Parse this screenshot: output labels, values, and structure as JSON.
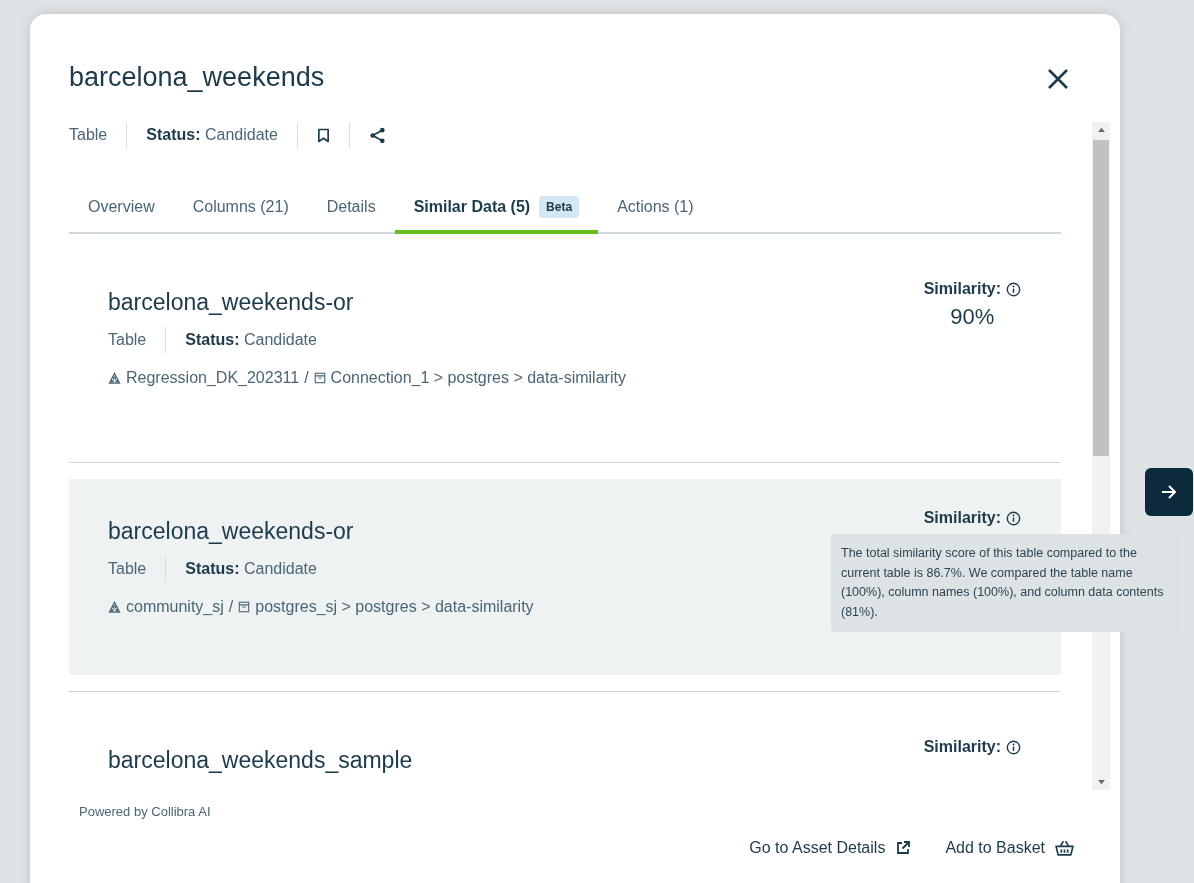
{
  "dialog": {
    "title": "barcelona_weekends",
    "type": "Table",
    "status_label": "Status:",
    "status": "Candidate"
  },
  "tabs": [
    {
      "label": "Overview",
      "selected": false
    },
    {
      "label": "Columns (21)",
      "selected": false
    },
    {
      "label": "Details",
      "selected": false
    },
    {
      "label": "Similar Data (5)",
      "badge": "Beta",
      "selected": true
    },
    {
      "label": "Actions (1)",
      "selected": false
    }
  ],
  "results": [
    {
      "title": "barcelona_weekends-or",
      "type": "Table",
      "status_label": "Status:",
      "status": "Candidate",
      "path": [
        {
          "kind": "community",
          "text": "Regression_DK_202311"
        },
        {
          "kind": "separator",
          "text": "/"
        },
        {
          "kind": "system",
          "text": "Connection_1 > postgres > data-similarity"
        }
      ],
      "similarity_label": "Similarity:",
      "similarity": "90%",
      "highlighted": false
    },
    {
      "title": "barcelona_weekends-or",
      "type": "Table",
      "status_label": "Status:",
      "status": "Candidate",
      "path": [
        {
          "kind": "community",
          "text": "community_sj"
        },
        {
          "kind": "separator",
          "text": "/"
        },
        {
          "kind": "system",
          "text": "postgres_sj > postgres > data-similarity"
        }
      ],
      "similarity_label": "Similarity:",
      "highlighted": true,
      "tooltip": "The total similarity score of this table compared to the current table is 86.7%. We compared the table name (100%), column names (100%), and column data contents (81%)."
    },
    {
      "title": "barcelona_weekends_sample",
      "similarity_label": "Similarity:",
      "highlighted": false
    }
  ],
  "footer": {
    "credit": "Powered by Collibra AI",
    "actions": [
      {
        "label": "Go to Asset Details",
        "kind": "link"
      },
      {
        "label": "Add to Basket",
        "kind": "basket"
      }
    ]
  }
}
